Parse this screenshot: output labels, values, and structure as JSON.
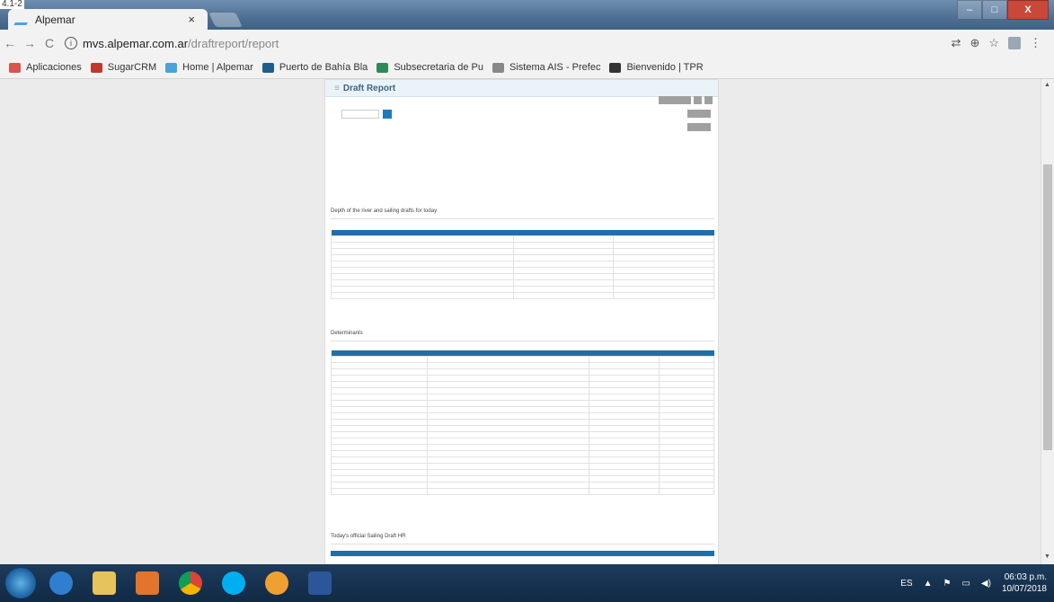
{
  "caption": "4.1-2",
  "browser": {
    "tab_title": "Alpemar",
    "tab_close": "×",
    "url_host": "mvs.alpemar.com.ar",
    "url_path": "/draftreport/report",
    "window_controls": [
      "–",
      "□",
      "X"
    ]
  },
  "bookmarks": [
    {
      "label": "Aplicaciones",
      "color": "#d9534f"
    },
    {
      "label": "SugarCRM",
      "color": "#c0392b"
    },
    {
      "label": "Home | Alpemar",
      "color": "#4aa3d8"
    },
    {
      "label": "Puerto de Bahía Bla",
      "color": "#1f5e8c"
    },
    {
      "label": "Subsecretaria de Pu",
      "color": "#2e8b57"
    },
    {
      "label": "Sistema AIS - Prefec",
      "color": "#888888"
    },
    {
      "label": "Bienvenido | TPR",
      "color": "#333333"
    }
  ],
  "report": {
    "header_tag": "≡",
    "header": "Draft Report",
    "section1_title": "Depth of the river and sailing drafts for today",
    "section2_title": "Determinants",
    "section3_title": "Today's official Sailing Draft HR"
  },
  "taskbar": {
    "lang": "ES",
    "time": "06:03 p.m.",
    "date": "10/07/2018"
  },
  "colors": {
    "accent": "#1f6fa8",
    "viewport_bg": "#ebebeb"
  }
}
